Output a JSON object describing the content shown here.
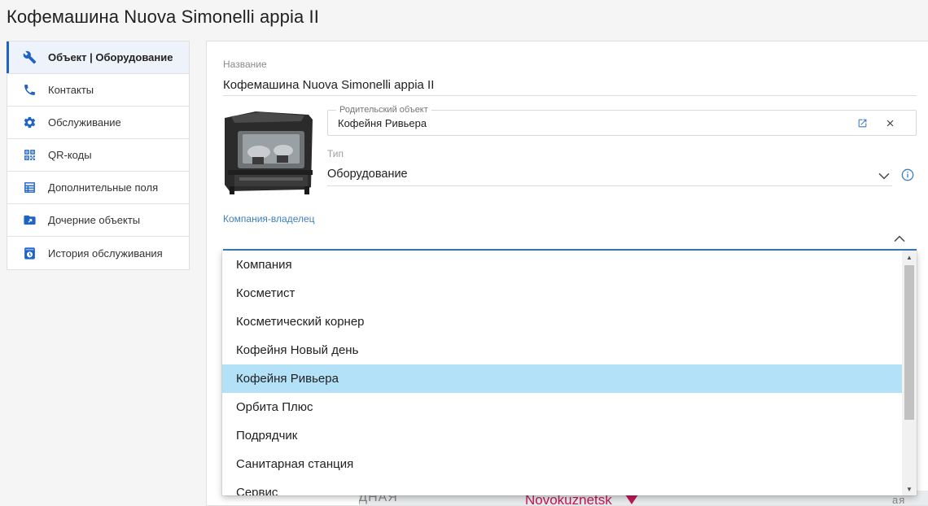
{
  "page": {
    "title": "Кофемашина Nuova Simonelli appia II"
  },
  "sidebar": {
    "items": [
      {
        "label": "Объект | Оборудование",
        "icon": "wrench-icon"
      },
      {
        "label": "Контакты",
        "icon": "phone-icon"
      },
      {
        "label": "Обслуживание",
        "icon": "gear-icon"
      },
      {
        "label": "QR-коды",
        "icon": "qr-code-icon"
      },
      {
        "label": "Дополнительные поля",
        "icon": "list-icon"
      },
      {
        "label": "Дочерние объекты",
        "icon": "folder-icon"
      },
      {
        "label": "История обслуживания",
        "icon": "history-icon"
      }
    ]
  },
  "form": {
    "name_label": "Название",
    "name_value": "Кофемашина Nuova Simonelli appia II",
    "parent_label": "Родительский объект",
    "parent_value": "Кофейня Ривьера",
    "type_label": "Тип",
    "type_value": "Оборудование",
    "owner_label": "Компания-владелец",
    "owner_value": ""
  },
  "dropdown": {
    "options": [
      "Компания",
      "Косметист",
      "Косметический корнер",
      "Кофейня Новый день",
      "Кофейня Ривьера",
      "Орбита Плюс",
      "Подрядчик",
      "Санитарная станция",
      "Сервис"
    ],
    "selected": "Кофейня Ривьера"
  },
  "map": {
    "city_label": "Novokuznetsk",
    "street_fragment": "ХОДНАЯ",
    "side_fragment": "ая"
  },
  "colors": {
    "accent": "#1e63c6",
    "selected_option": "#b3e2f8",
    "owner_label": "#3d7fbf",
    "map_label": "#c2185b"
  }
}
